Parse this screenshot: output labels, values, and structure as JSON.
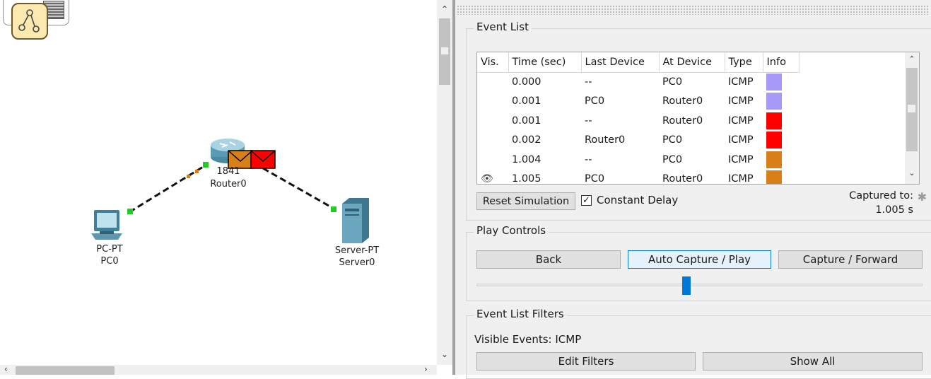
{
  "workspace": {
    "devices": [
      {
        "model": "PC-PT",
        "name": "PC0"
      },
      {
        "model": "1841",
        "name": "Router0"
      },
      {
        "model": "Server-PT",
        "name": "Server0"
      }
    ]
  },
  "event_list": {
    "title": "Event List",
    "columns": [
      "Vis.",
      "Time (sec)",
      "Last Device",
      "At Device",
      "Type",
      "Info"
    ],
    "rows": [
      {
        "vis": "",
        "time": "0.000",
        "last": "--",
        "at": "PC0",
        "type": "ICMP",
        "info_color": "#a699f7"
      },
      {
        "vis": "",
        "time": "0.001",
        "last": "PC0",
        "at": "Router0",
        "type": "ICMP",
        "info_color": "#a699f7"
      },
      {
        "vis": "",
        "time": "0.001",
        "last": "--",
        "at": "Router0",
        "type": "ICMP",
        "info_color": "#ff0000"
      },
      {
        "vis": "",
        "time": "0.002",
        "last": "Router0",
        "at": "PC0",
        "type": "ICMP",
        "info_color": "#ff0000"
      },
      {
        "vis": "",
        "time": "1.004",
        "last": "--",
        "at": "PC0",
        "type": "ICMP",
        "info_color": "#d97f18"
      },
      {
        "vis": "eye",
        "time": "1.005",
        "last": "PC0",
        "at": "Router0",
        "type": "ICMP",
        "info_color": "#d97f18"
      }
    ],
    "reset_button": "Reset Simulation",
    "constant_delay_label": "Constant Delay",
    "constant_delay_checked": true,
    "captured_label": "Captured to:",
    "captured_value": "1.005 s"
  },
  "play_controls": {
    "title": "Play Controls",
    "back": "Back",
    "auto_capture": "Auto Capture / Play",
    "capture_forward": "Capture / Forward",
    "speed_fraction": 0.47
  },
  "filters": {
    "title": "Event List Filters",
    "visible_events": "Visible Events: ICMP",
    "edit_filters": "Edit Filters",
    "show_all": "Show All"
  },
  "colors": {
    "link_up": "#22cc22",
    "packet_orange": "#d97f18",
    "packet_red": "#ff0000",
    "accent": "#0078d7"
  }
}
